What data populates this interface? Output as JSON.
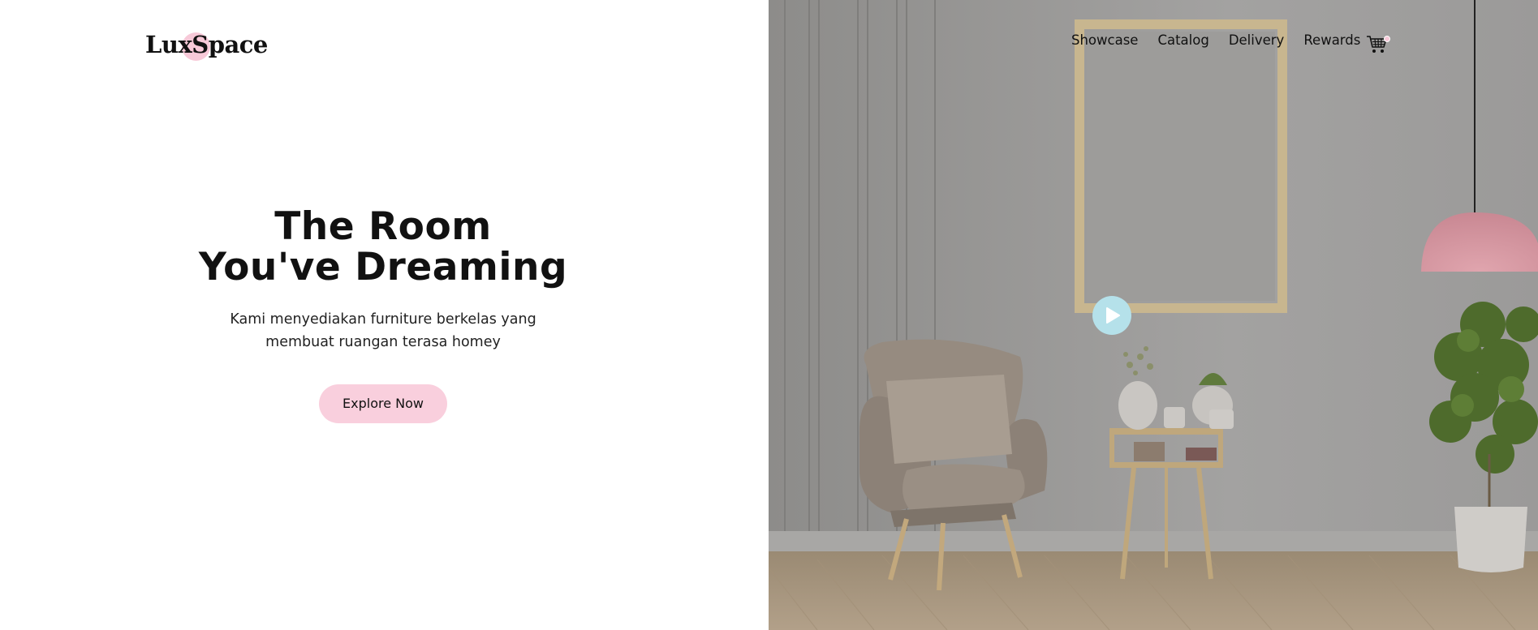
{
  "brand": {
    "name": "LuxSpace"
  },
  "hero": {
    "title_line1": "The Room",
    "title_line2": "You've Dreaming",
    "subtitle_line1": "Kami menyediakan furniture berkelas yang",
    "subtitle_line2": "membuat ruangan terasa homey",
    "cta_label": "Explore Now"
  },
  "nav": {
    "items": [
      {
        "label": "Showcase"
      },
      {
        "label": "Catalog"
      },
      {
        "label": "Delivery"
      },
      {
        "label": "Rewards"
      }
    ],
    "cart_icon": "shopping-cart-icon"
  },
  "media": {
    "play_icon": "play-icon"
  },
  "colors": {
    "accent_pink": "#f9cfdd",
    "play_button": "#b5e1ea",
    "text": "#111111"
  }
}
